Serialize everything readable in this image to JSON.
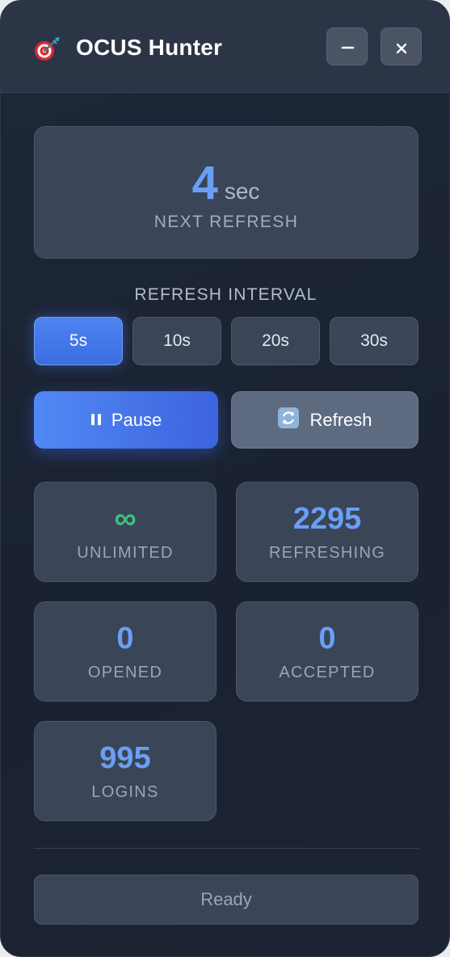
{
  "app": {
    "title": "OCUS Hunter",
    "icon": "target-dart-icon"
  },
  "window_controls": {
    "minimize_icon": "minus-icon",
    "close_icon": "close-icon"
  },
  "countdown": {
    "value": "4",
    "unit": "sec",
    "label": "NEXT REFRESH"
  },
  "interval": {
    "label": "REFRESH INTERVAL",
    "options": [
      "5s",
      "10s",
      "20s",
      "30s"
    ],
    "selected": "5s"
  },
  "actions": {
    "pause_label": "Pause",
    "pause_icon": "pause-icon",
    "refresh_label": "Refresh",
    "refresh_icon": "refresh-icon"
  },
  "stats": {
    "unlimited": {
      "value": "∞",
      "label": "UNLIMITED"
    },
    "refreshing": {
      "value": "2295",
      "label": "REFRESHING"
    },
    "opened": {
      "value": "0",
      "label": "OPENED"
    },
    "accepted": {
      "value": "0",
      "label": "ACCEPTED"
    },
    "logins": {
      "value": "995",
      "label": "LOGINS"
    }
  },
  "status": {
    "text": "Ready"
  },
  "colors": {
    "accent": "#6a9ff5",
    "primary_button": "#4a7ef0",
    "success": "#3fbf7f",
    "background": "#1e2838"
  }
}
